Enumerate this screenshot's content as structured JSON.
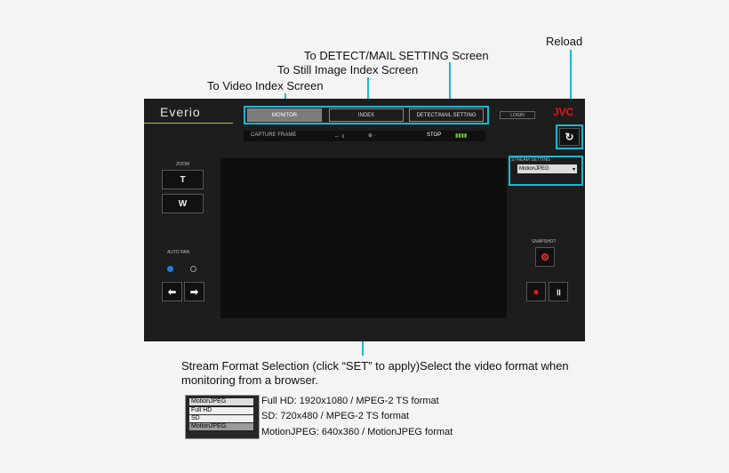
{
  "callouts": {
    "detect_mail": "To DETECT/MAIL SETTING Screen",
    "still_index": "To Still Image Index Screen",
    "video_index": "To Video Index Screen",
    "reload": "Reload"
  },
  "app": {
    "brand": "Everio",
    "tabs": [
      "MONITOR",
      "INDEX",
      "DETECT/MAIL SETTING"
    ],
    "login": "LOGIN",
    "logo": "JVC",
    "toolbar": {
      "capture": "CAPTURE FRAME",
      "stop": "STOP"
    },
    "zoom_label": "ZOOM",
    "zoom_t": "T",
    "zoom_w": "W",
    "pan_label": "AUTO PAN",
    "stream_label": "STREAM SETTING",
    "stream_value": "MotionJPEG",
    "snapshot_label": "SNAPSHOT"
  },
  "description": "Stream Format Selection (click “SET” to apply)Select the video format when monitoring from a browser.",
  "sample_select": {
    "selected": "MotionJPEG",
    "options": [
      "Full HD",
      "SD",
      "MotionJPEG"
    ]
  },
  "formats": [
    "Full HD: 1920x1080 / MPEG-2 TS format",
    "SD: 720x480 / MPEG-2 TS format",
    "MotionJPEG: 640x360 / MotionJPEG format"
  ]
}
